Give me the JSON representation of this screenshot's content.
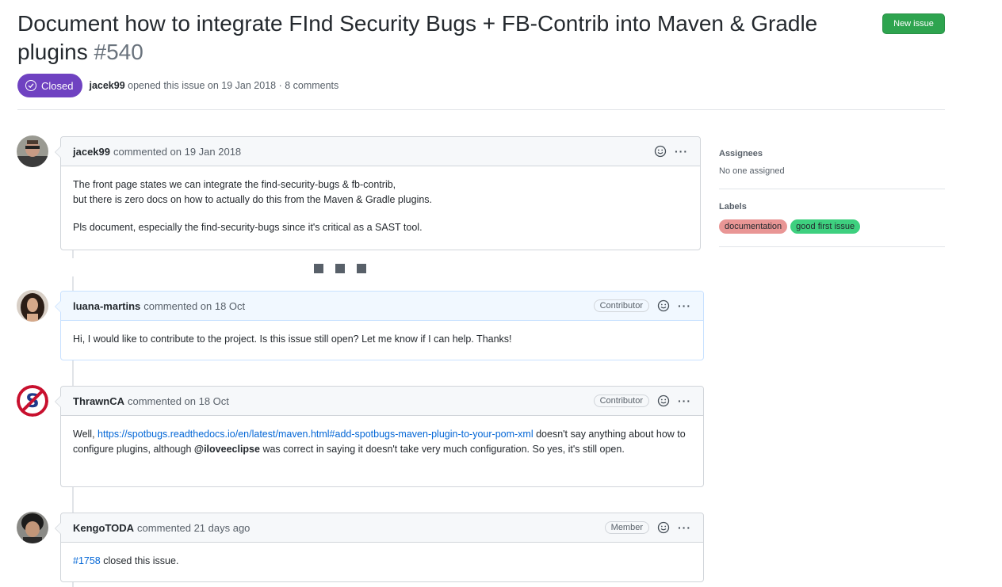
{
  "issue": {
    "title": "Document how to integrate FInd Security Bugs + FB-Contrib into Maven & Gradle plugins",
    "number": "#540",
    "state": "Closed",
    "author": "jacek99",
    "opened_text": "opened this issue on 19 Jan 2018 · 8 comments"
  },
  "header": {
    "new_issue_label": "New issue"
  },
  "comments": [
    {
      "author": "jacek99",
      "meta": "commented on 19 Jan 2018",
      "body": [
        "The front page states we can integrate the find-security-bugs & fb-contrib,",
        "but there is zero docs on how to actually do this from the Maven & Gradle plugins.",
        "Pls document, especially the find-security-bugs since it's critical as a SAST tool."
      ]
    },
    {
      "author": "luana-martins",
      "meta": "commented on 18 Oct",
      "badge": "Contributor",
      "body": [
        "Hi, I would like to contribute to the project. Is this issue still open? Let me know if I can help. Thanks!"
      ]
    },
    {
      "author": "ThrawnCA",
      "meta": "commented on 18 Oct",
      "badge": "Contributor",
      "body_pre": "Well, ",
      "body_link": "https://spotbugs.readthedocs.io/en/latest/maven.html#add-spotbugs-maven-plugin-to-your-pom-xml",
      "body_mid": " doesn't say anything about how to configure plugins, although ",
      "body_mention": "@iloveeclipse",
      "body_post": " was correct in saying it doesn't take very much configuration. So yes, it's still open."
    },
    {
      "author": "KengoTODA",
      "meta": "commented 21 days ago",
      "badge": "Member",
      "body_link": "#1758",
      "body_post": " closed this issue."
    }
  ],
  "sidebar": {
    "assignees_title": "Assignees",
    "assignees_value": "No one assigned",
    "labels_title": "Labels",
    "labels": [
      {
        "name": "documentation",
        "color": "#e99695"
      },
      {
        "name": "good first issue",
        "color": "#3ed07f"
      }
    ]
  },
  "colors": {
    "closed": "#6f42c1",
    "new_issue": "#2ea44f",
    "link": "#0366d6"
  },
  "icons": [
    "check-circle-icon",
    "smiley-icon",
    "kebab-horizontal-icon"
  ]
}
